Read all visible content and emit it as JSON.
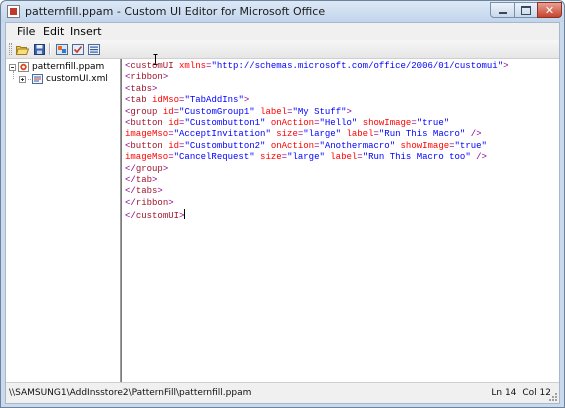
{
  "window": {
    "title": "patternfill.ppam - Custom UI Editor for Microsoft Office"
  },
  "menu": {
    "items": [
      "File",
      "Edit",
      "Insert"
    ]
  },
  "toolbar": {
    "buttons": [
      "open-icon",
      "save-icon",
      "insert-image-icon",
      "validate-icon",
      "callbacks-icon"
    ]
  },
  "tree": {
    "root_label": "patternfill.ppam",
    "child_label": "customUI.xml"
  },
  "editor": {
    "lines": [
      [
        [
          "tag",
          "<"
        ],
        [
          "elname",
          "customUI"
        ],
        [
          "txt",
          " "
        ],
        [
          "attr",
          "xmlns"
        ],
        [
          "tag",
          "="
        ],
        [
          "val",
          "\"http://schemas.microsoft.com/office/2006/01/customui\""
        ],
        [
          "tag",
          ">"
        ]
      ],
      [
        [
          "tag",
          "<"
        ],
        [
          "elname",
          "ribbon"
        ],
        [
          "tag",
          ">"
        ]
      ],
      [
        [
          "tag",
          "<"
        ],
        [
          "elname",
          "tabs"
        ],
        [
          "tag",
          ">"
        ]
      ],
      [
        [
          "tag",
          "<"
        ],
        [
          "elname",
          "tab"
        ],
        [
          "txt",
          " "
        ],
        [
          "attr",
          "idMso"
        ],
        [
          "tag",
          "="
        ],
        [
          "val",
          "\"TabAddIns\""
        ],
        [
          "tag",
          ">"
        ]
      ],
      [
        [
          "tag",
          "<"
        ],
        [
          "elname",
          "group"
        ],
        [
          "txt",
          " "
        ],
        [
          "attr",
          "id"
        ],
        [
          "tag",
          "="
        ],
        [
          "val",
          "\"CustomGroup1\""
        ],
        [
          "txt",
          " "
        ],
        [
          "attr",
          "label"
        ],
        [
          "tag",
          "="
        ],
        [
          "val",
          "\"My Stuff\""
        ],
        [
          "tag",
          ">"
        ]
      ],
      [
        [
          "tag",
          "<"
        ],
        [
          "elname",
          "button"
        ],
        [
          "txt",
          " "
        ],
        [
          "attr",
          "id"
        ],
        [
          "tag",
          "="
        ],
        [
          "val",
          "\"Custombutton1\""
        ],
        [
          "txt",
          " "
        ],
        [
          "attr",
          "onAction"
        ],
        [
          "tag",
          "="
        ],
        [
          "val",
          "\"Hello\""
        ],
        [
          "txt",
          " "
        ],
        [
          "attr",
          "showImage"
        ],
        [
          "tag",
          "="
        ],
        [
          "val",
          "\"true\""
        ]
      ],
      [
        [
          "attr",
          "imageMso"
        ],
        [
          "tag",
          "="
        ],
        [
          "val",
          "\"AcceptInvitation\""
        ],
        [
          "txt",
          " "
        ],
        [
          "attr",
          "size"
        ],
        [
          "tag",
          "="
        ],
        [
          "val",
          "\"large\""
        ],
        [
          "txt",
          " "
        ],
        [
          "attr",
          "label"
        ],
        [
          "tag",
          "="
        ],
        [
          "val",
          "\"Run This Macro\""
        ],
        [
          "txt",
          " "
        ],
        [
          "tag",
          "/>"
        ]
      ],
      [
        [
          "tag",
          "<"
        ],
        [
          "elname",
          "button"
        ],
        [
          "txt",
          " "
        ],
        [
          "attr",
          "id"
        ],
        [
          "tag",
          "="
        ],
        [
          "val",
          "\"Custombutton2\""
        ],
        [
          "txt",
          " "
        ],
        [
          "attr",
          "onAction"
        ],
        [
          "tag",
          "="
        ],
        [
          "val",
          "\"Anothermacro\""
        ],
        [
          "txt",
          " "
        ],
        [
          "attr",
          "showImage"
        ],
        [
          "tag",
          "="
        ],
        [
          "val",
          "\"true\""
        ]
      ],
      [
        [
          "attr",
          "imageMso"
        ],
        [
          "tag",
          "="
        ],
        [
          "val",
          "\"CancelRequest\""
        ],
        [
          "txt",
          " "
        ],
        [
          "attr",
          "size"
        ],
        [
          "tag",
          "="
        ],
        [
          "val",
          "\"large\""
        ],
        [
          "txt",
          " "
        ],
        [
          "attr",
          "label"
        ],
        [
          "tag",
          "="
        ],
        [
          "val",
          "\"Run This Macro too\""
        ],
        [
          "txt",
          " "
        ],
        [
          "tag",
          "/>"
        ]
      ],
      [
        [
          "tag",
          "</"
        ],
        [
          "elname",
          "group"
        ],
        [
          "tag",
          ">"
        ]
      ],
      [
        [
          "tag",
          "</"
        ],
        [
          "elname",
          "tab"
        ],
        [
          "tag",
          ">"
        ]
      ],
      [
        [
          "tag",
          "</"
        ],
        [
          "elname",
          "tabs"
        ],
        [
          "tag",
          ">"
        ]
      ],
      [
        [
          "tag",
          "</"
        ],
        [
          "elname",
          "ribbon"
        ],
        [
          "tag",
          ">"
        ]
      ],
      [
        [
          "tag",
          "</"
        ],
        [
          "elname",
          "customUI"
        ],
        [
          "tag",
          ">"
        ]
      ]
    ]
  },
  "status": {
    "path": "\\\\SAMSUNG1\\AddInsstore2\\PatternFill\\patternfill.ppam",
    "line": "Ln 14",
    "col": "Col 12"
  },
  "colors": {
    "tag": "#8b008b",
    "element": "#a0162c",
    "attribute": "#ff0000",
    "value": "#0000ff"
  }
}
